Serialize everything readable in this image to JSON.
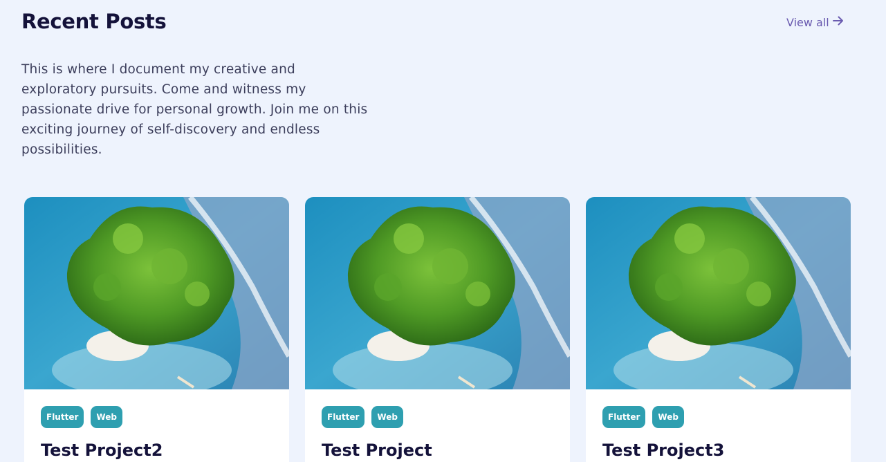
{
  "header": {
    "title": "Recent Posts",
    "view_all_label": "View all"
  },
  "intro": "This is where I document my creative and exploratory pursuits. Come and witness my passionate drive for personal growth. Join me on this exciting journey of self-discovery and endless possibilities.",
  "colors": {
    "background": "#eef3fd",
    "title": "#14123a",
    "accent_link": "#6a5bb0",
    "tag_bg": "#2e9fb0"
  },
  "posts": [
    {
      "title": "Test Project2",
      "tags": [
        "Flutter",
        "Web"
      ],
      "image": "island-aerial-photo"
    },
    {
      "title": "Test Project",
      "tags": [
        "Flutter",
        "Web"
      ],
      "image": "island-aerial-photo"
    },
    {
      "title": "Test Project3",
      "tags": [
        "Flutter",
        "Web"
      ],
      "image": "island-aerial-photo"
    }
  ]
}
